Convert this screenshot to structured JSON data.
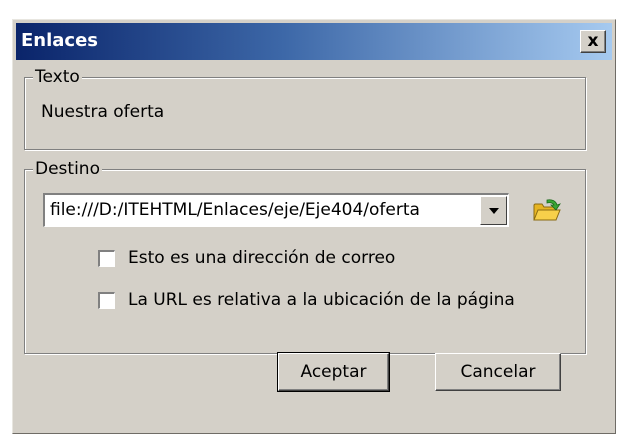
{
  "window": {
    "title": "Enlaces",
    "close_label": "x"
  },
  "texto_group": {
    "legend": "Texto",
    "value": "Nuestra oferta"
  },
  "destino_group": {
    "legend": "Destino",
    "url_value": "file:///D:/ITEHTML/Enlaces/eje/Eje404/oferta",
    "folder_icon": "open-folder-icon",
    "checkboxes": [
      {
        "label": "Esto es una dirección de correo",
        "checked": false
      },
      {
        "label": "La URL es relativa a la ubicación de la página",
        "checked": false
      }
    ]
  },
  "buttons": {
    "ok": "Aceptar",
    "cancel": "Cancelar"
  },
  "colors": {
    "title_gradient_start": "#0a246a",
    "title_gradient_end": "#a6caf0",
    "dialog_face": "#d4d0c8",
    "folder_yellow": "#f2c02a",
    "arrow_green": "#3aa635"
  }
}
